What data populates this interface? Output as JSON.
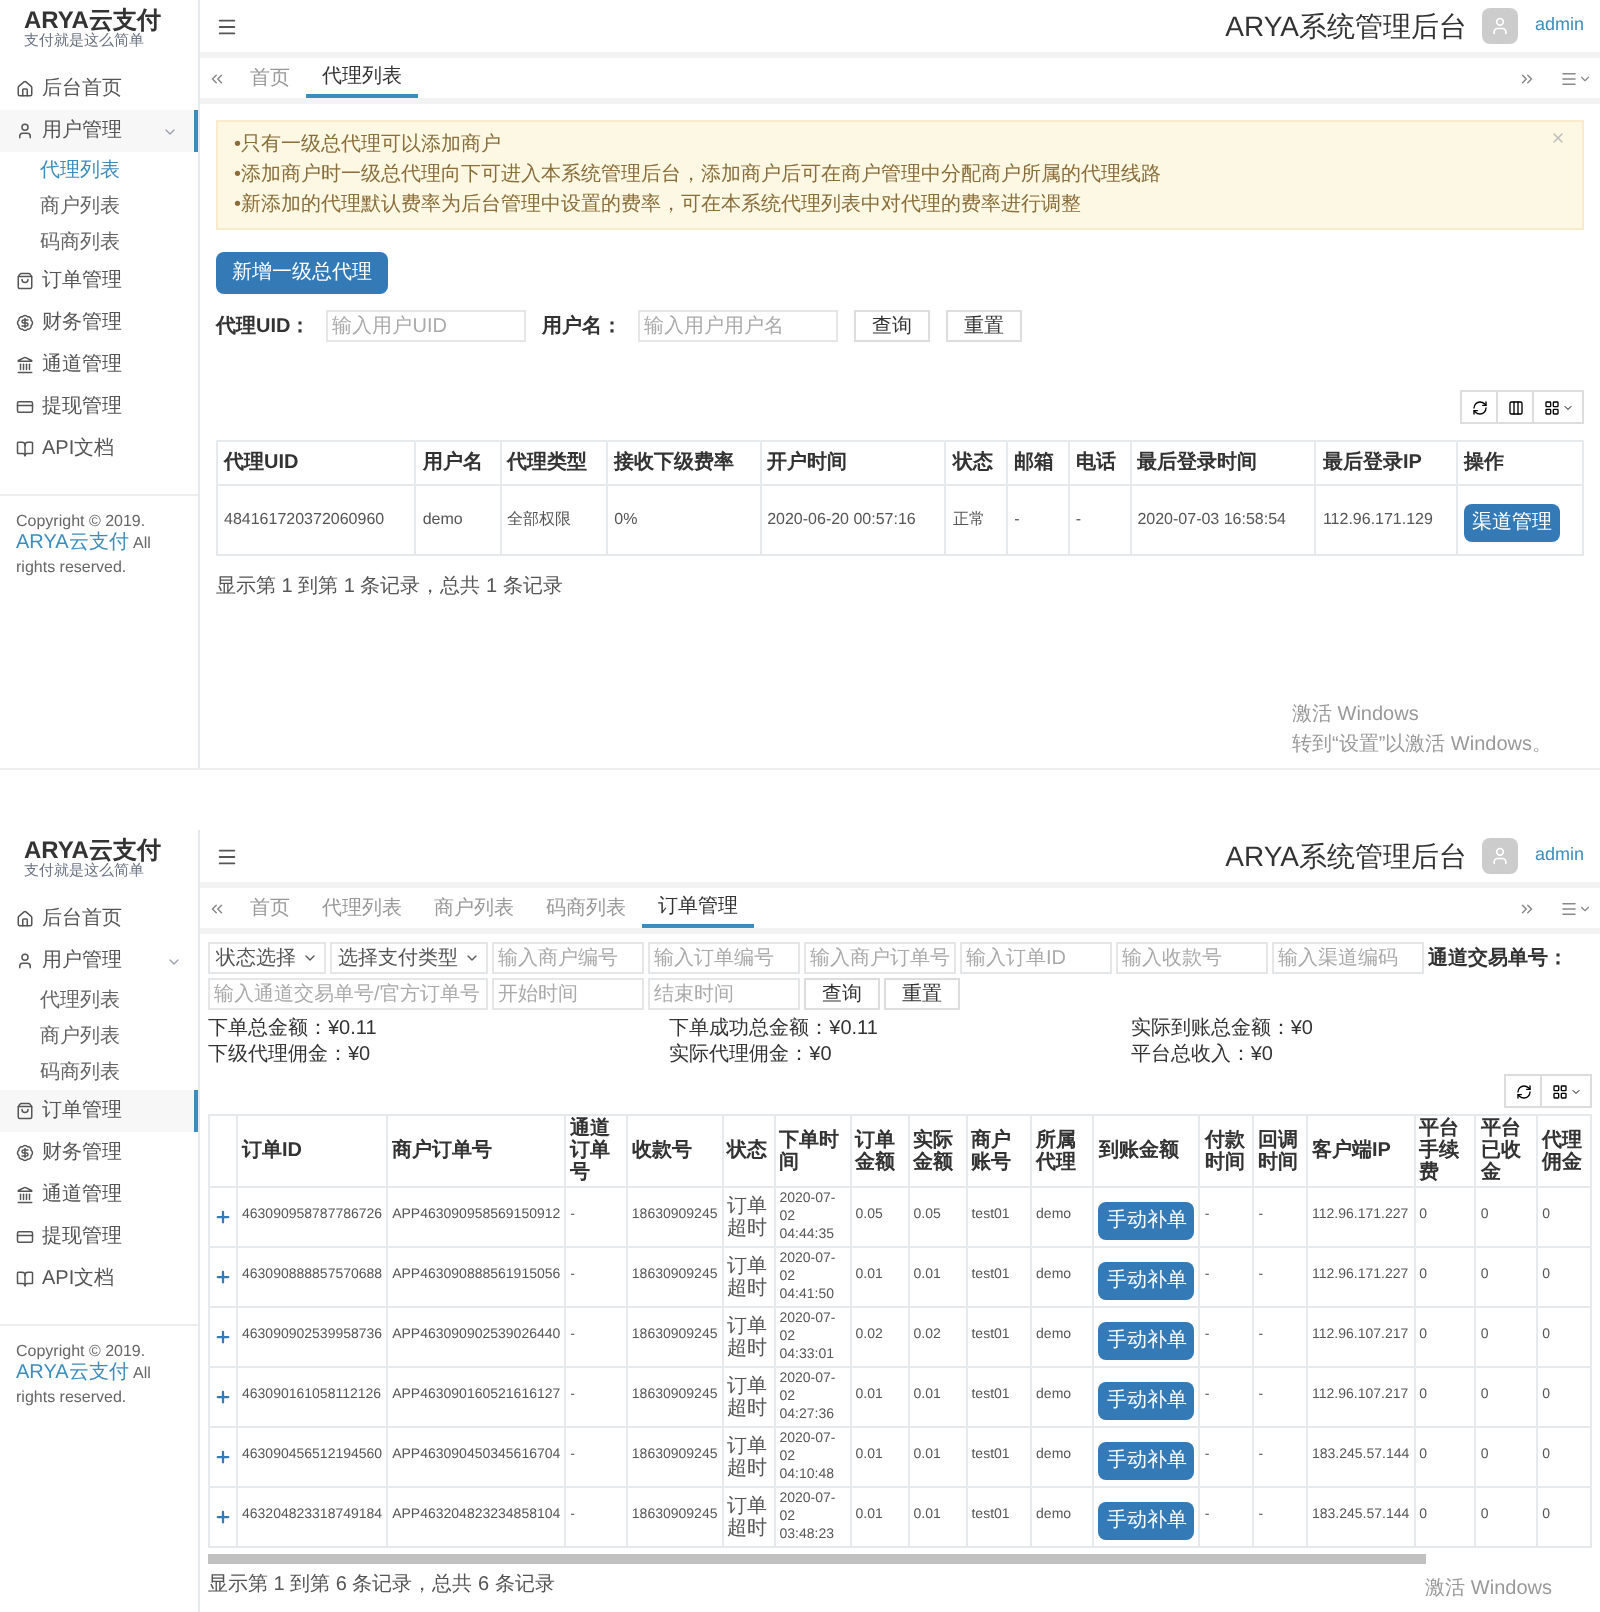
{
  "agent_screen": {
    "logo": {
      "name": "ARYA云支付",
      "slogan": "支付就是这么简单"
    },
    "header": {
      "title": "ARYA系统管理后台",
      "user": "admin"
    },
    "sidebar": [
      {
        "kind": "link",
        "label": "后台首页",
        "selected": false
      },
      {
        "kind": "group",
        "label": "用户管理",
        "selected": true,
        "expanded": true,
        "children": [
          {
            "label": "代理列表",
            "selected": true
          },
          {
            "label": "商户列表",
            "selected": false
          },
          {
            "label": "码商列表",
            "selected": false
          }
        ]
      },
      {
        "kind": "link",
        "label": "订单管理",
        "selected": false
      },
      {
        "kind": "link",
        "label": "财务管理",
        "selected": false
      },
      {
        "kind": "link",
        "label": "通道管理",
        "selected": false
      },
      {
        "kind": "link",
        "label": "提现管理",
        "selected": false
      },
      {
        "kind": "link",
        "label": "API文档",
        "selected": false
      }
    ],
    "copyright": {
      "text": "Copyright © 2019. ",
      "link": "ARYA云支付",
      "suffix": " All rights reserved."
    },
    "tabs": [
      {
        "label": "首页",
        "selected": false
      },
      {
        "label": "代理列表",
        "selected": true
      }
    ],
    "notice": [
      "•只有一级总代理可以添加商户",
      "•添加商户时一级总代理向下可进入本系统管理后台，添加商户后可在商户管理中分配商户所属的代理线路",
      "•新添加的代理默认费率为后台管理中设置的费率，可在本系统代理列表中对代理的费率进行调整"
    ],
    "add_button": "新增一级总代理",
    "filters": [
      {
        "kind": "label",
        "text": "代理UID："
      },
      {
        "kind": "input",
        "placeholder": "输入用户UID"
      },
      {
        "kind": "label",
        "text": "用户名："
      },
      {
        "kind": "input",
        "placeholder": "输入用户用户名"
      },
      {
        "kind": "button",
        "label": "查询"
      },
      {
        "kind": "button",
        "label": "重置"
      }
    ],
    "table": {
      "expandable": false,
      "columns": [
        {
          "label": "代理UID",
          "kind": "text"
        },
        {
          "label": "用户名",
          "kind": "text"
        },
        {
          "label": "代理类型",
          "kind": "text"
        },
        {
          "label": "接收下级费率",
          "kind": "text"
        },
        {
          "label": "开户时间",
          "kind": "text"
        },
        {
          "label": "状态",
          "kind": "text"
        },
        {
          "label": "邮箱",
          "kind": "text"
        },
        {
          "label": "电话",
          "kind": "text"
        },
        {
          "label": "最后登录时间",
          "kind": "text"
        },
        {
          "label": "最后登录IP",
          "kind": "text"
        },
        {
          "label": "操作",
          "kind": "button"
        }
      ],
      "rows": [
        {
          "cells": [
            "484161720372060960",
            "demo",
            "全部权限",
            "0%",
            "2020-06-20 00:57:16",
            "正常",
            "-",
            "-",
            "2020-07-03 16:58:54",
            "112.96.171.129",
            "渠道管理"
          ]
        }
      ]
    },
    "footer": "显示第 1 到第 1 条记录，总共 1 条记录",
    "os_notice": [
      "激活 Windows",
      "转到“设置”以激活 Windows。"
    ]
  },
  "order_screen": {
    "logo": {
      "name": "ARYA云支付",
      "slogan": "支付就是这么简单"
    },
    "header": {
      "title": "ARYA系统管理后台",
      "user": "admin"
    },
    "sidebar": [
      {
        "kind": "link",
        "label": "后台首页",
        "selected": false
      },
      {
        "kind": "group",
        "label": "用户管理",
        "selected": false,
        "expanded": true,
        "children": [
          {
            "label": "代理列表",
            "selected": false
          },
          {
            "label": "商户列表",
            "selected": false
          },
          {
            "label": "码商列表",
            "selected": false
          }
        ]
      },
      {
        "kind": "link",
        "label": "订单管理",
        "selected": true
      },
      {
        "kind": "link",
        "label": "财务管理",
        "selected": false
      },
      {
        "kind": "link",
        "label": "通道管理",
        "selected": false
      },
      {
        "kind": "link",
        "label": "提现管理",
        "selected": false
      },
      {
        "kind": "link",
        "label": "API文档",
        "selected": false
      }
    ],
    "copyright": {
      "text": "Copyright © 2019. ",
      "link": "ARYA云支付",
      "suffix": " All rights reserved."
    },
    "tabs": [
      {
        "label": "首页",
        "selected": false
      },
      {
        "label": "代理列表",
        "selected": false
      },
      {
        "label": "商户列表",
        "selected": false
      },
      {
        "label": "码商列表",
        "selected": false
      },
      {
        "label": "订单管理",
        "selected": true
      }
    ],
    "filters": [
      {
        "kind": "select",
        "value": "状态选择"
      },
      {
        "kind": "select",
        "value": "选择支付类型"
      },
      {
        "kind": "input",
        "placeholder": "输入商户编号"
      },
      {
        "kind": "input",
        "placeholder": "输入订单编号"
      },
      {
        "kind": "input",
        "placeholder": "输入商户订单号"
      },
      {
        "kind": "input",
        "placeholder": "输入订单ID"
      },
      {
        "kind": "input",
        "placeholder": "输入收款号"
      },
      {
        "kind": "input",
        "placeholder": "输入渠道编码"
      },
      {
        "kind": "label",
        "text": "通道交易单号："
      },
      {
        "kind": "input",
        "placeholder": "输入通道交易单号/官方订单号"
      },
      {
        "kind": "input",
        "placeholder": "开始时间"
      },
      {
        "kind": "input",
        "placeholder": "结束时间"
      },
      {
        "kind": "button",
        "label": "查询"
      },
      {
        "kind": "button",
        "label": "重置"
      }
    ],
    "stats": [
      {
        "label": "下单总金额：",
        "value": "¥0.11"
      },
      {
        "label": "下单成功总金额：",
        "value": "¥0.11"
      },
      {
        "label": "实际到账总金额：",
        "value": "¥0"
      },
      {
        "label": "下级代理佣金：",
        "value": "¥0"
      },
      {
        "label": "实际代理佣金：",
        "value": "¥0"
      },
      {
        "label": "平台总收入：",
        "value": "¥0"
      }
    ],
    "table": {
      "expandable": true,
      "columns": [
        {
          "label": "订单ID",
          "kind": "text"
        },
        {
          "label": "商户订单号",
          "kind": "text"
        },
        {
          "label": "通道订单号",
          "kind": "text"
        },
        {
          "label": "收款号",
          "kind": "text"
        },
        {
          "label": "状态",
          "kind": "status"
        },
        {
          "label": "下单时间",
          "kind": "time"
        },
        {
          "label": "订单金额",
          "kind": "text"
        },
        {
          "label": "实际金额",
          "kind": "text"
        },
        {
          "label": "商户账号",
          "kind": "text"
        },
        {
          "label": "所属代理",
          "kind": "text"
        },
        {
          "label": "到账金额",
          "kind": "button"
        },
        {
          "label": "付款时间",
          "kind": "text"
        },
        {
          "label": "回调时间",
          "kind": "text"
        },
        {
          "label": "客户端IP",
          "kind": "text"
        },
        {
          "label": "平台手续费",
          "kind": "text"
        },
        {
          "label": "平台已收金",
          "kind": "text"
        },
        {
          "label": "代理佣金",
          "kind": "text"
        }
      ],
      "rows": [
        {
          "cells": [
            "463090958787786726",
            "APP463090958569150912",
            "-",
            "18630909245",
            "订单超时",
            "2020-07-02 04:44:35",
            "0.05",
            "0.05",
            "test01",
            "demo",
            "手动补单",
            "-",
            "-",
            "112.96.171.227",
            "0",
            "0",
            "0"
          ]
        },
        {
          "cells": [
            "463090888857570688",
            "APP463090888561915056",
            "-",
            "18630909245",
            "订单超时",
            "2020-07-02 04:41:50",
            "0.01",
            "0.01",
            "test01",
            "demo",
            "手动补单",
            "-",
            "-",
            "112.96.171.227",
            "0",
            "0",
            "0"
          ]
        },
        {
          "cells": [
            "463090902539958736",
            "APP463090902539026440",
            "-",
            "18630909245",
            "订单超时",
            "2020-07-02 04:33:01",
            "0.02",
            "0.02",
            "test01",
            "demo",
            "手动补单",
            "-",
            "-",
            "112.96.107.217",
            "0",
            "0",
            "0"
          ]
        },
        {
          "cells": [
            "463090161058112126",
            "APP463090160521616127",
            "-",
            "18630909245",
            "订单超时",
            "2020-07-02 04:27:36",
            "0.01",
            "0.01",
            "test01",
            "demo",
            "手动补单",
            "-",
            "-",
            "112.96.107.217",
            "0",
            "0",
            "0"
          ]
        },
        {
          "cells": [
            "463090456512194560",
            "APP463090450345616704",
            "-",
            "18630909245",
            "订单超时",
            "2020-07-02 04:10:48",
            "0.01",
            "0.01",
            "test01",
            "demo",
            "手动补单",
            "-",
            "-",
            "183.245.57.144",
            "0",
            "0",
            "0"
          ]
        },
        {
          "cells": [
            "463204823318749184",
            "APP463204823234858104",
            "-",
            "18630909245",
            "订单超时",
            "2020-07-02 03:48:23",
            "0.01",
            "0.01",
            "test01",
            "demo",
            "手动补单",
            "-",
            "-",
            "183.245.57.144",
            "0",
            "0",
            "0"
          ]
        }
      ]
    },
    "footer": "显示第 1 到第 6 条记录，总共 6 条记录",
    "os_notice": [
      "激活 Windows"
    ]
  }
}
